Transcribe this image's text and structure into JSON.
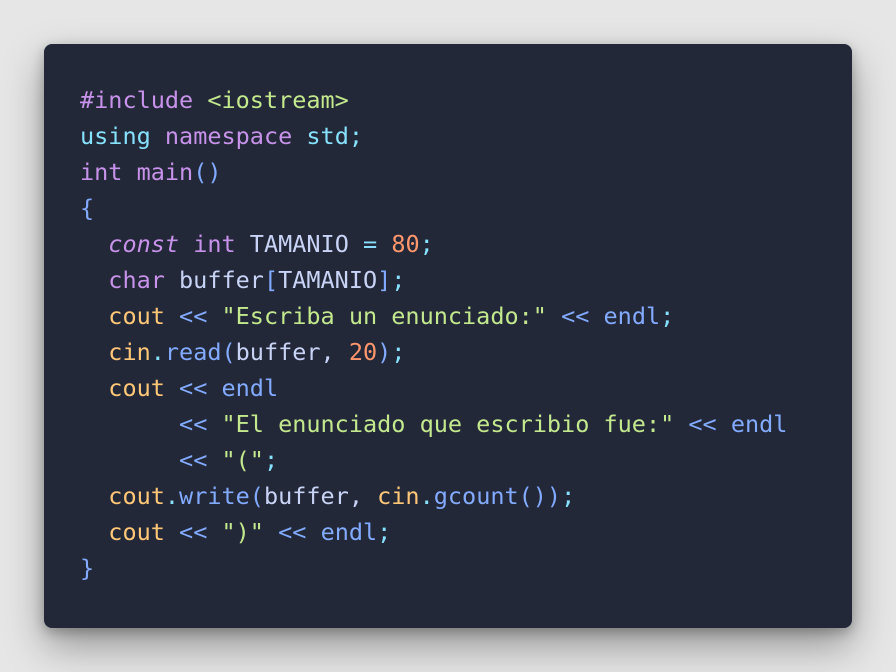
{
  "colors": {
    "background": "#e6e6e6",
    "editor_bg": "#232838",
    "keyword": "#c792ea",
    "type": "#ab8ff0",
    "identifier": "#c8d3f5",
    "function": "#82aaff",
    "operator": "#89ddff",
    "string": "#c3e88d",
    "number": "#ff966c",
    "stream": "#ffc777",
    "namespace_std": "#86e1fc",
    "punct": "#c8d3f5"
  },
  "code": {
    "language": "cpp",
    "lines": [
      {
        "tokens": [
          {
            "text": "#include",
            "color": "#c792ea"
          },
          {
            "text": " ",
            "color": "#c8d3f5"
          },
          {
            "text": "<iostream>",
            "color": "#c3e88d"
          }
        ]
      },
      {
        "tokens": [
          {
            "text": "using",
            "color": "#86e1fc"
          },
          {
            "text": " ",
            "color": "#c8d3f5"
          },
          {
            "text": "namespace",
            "color": "#c792ea"
          },
          {
            "text": " ",
            "color": "#c8d3f5"
          },
          {
            "text": "std",
            "color": "#86e1fc"
          },
          {
            "text": ";",
            "color": "#86e1fc"
          }
        ]
      },
      {
        "tokens": [
          {
            "text": "int",
            "color": "#c792ea"
          },
          {
            "text": " ",
            "color": "#c8d3f5"
          },
          {
            "text": "main",
            "color": "#c792ea"
          },
          {
            "text": "()",
            "color": "#82aaff"
          }
        ]
      },
      {
        "tokens": [
          {
            "text": "{",
            "color": "#82aaff"
          }
        ]
      },
      {
        "tokens": [
          {
            "text": "  ",
            "color": "#c8d3f5"
          },
          {
            "text": "const",
            "color": "#c792ea",
            "italic": true
          },
          {
            "text": " ",
            "color": "#c8d3f5"
          },
          {
            "text": "int",
            "color": "#c792ea"
          },
          {
            "text": " TAMANIO ",
            "color": "#c8d3f5"
          },
          {
            "text": "=",
            "color": "#89ddff"
          },
          {
            "text": " ",
            "color": "#c8d3f5"
          },
          {
            "text": "80",
            "color": "#ff966c"
          },
          {
            "text": ";",
            "color": "#86e1fc"
          }
        ]
      },
      {
        "tokens": [
          {
            "text": "  ",
            "color": "#c8d3f5"
          },
          {
            "text": "char",
            "color": "#c792ea"
          },
          {
            "text": " buffer",
            "color": "#c8d3f5"
          },
          {
            "text": "[",
            "color": "#82aaff"
          },
          {
            "text": "TAMANIO",
            "color": "#c8d3f5"
          },
          {
            "text": "]",
            "color": "#82aaff"
          },
          {
            "text": ";",
            "color": "#86e1fc"
          }
        ]
      },
      {
        "tokens": [
          {
            "text": "  ",
            "color": "#c8d3f5"
          },
          {
            "text": "cout",
            "color": "#ffc777"
          },
          {
            "text": " ",
            "color": "#c8d3f5"
          },
          {
            "text": "<<",
            "color": "#82aaff"
          },
          {
            "text": " ",
            "color": "#c8d3f5"
          },
          {
            "text": "\"Escriba un enunciado:\"",
            "color": "#c3e88d"
          },
          {
            "text": " ",
            "color": "#c8d3f5"
          },
          {
            "text": "<<",
            "color": "#82aaff"
          },
          {
            "text": " ",
            "color": "#c8d3f5"
          },
          {
            "text": "endl",
            "color": "#82aaff"
          },
          {
            "text": ";",
            "color": "#86e1fc"
          }
        ]
      },
      {
        "tokens": [
          {
            "text": "  ",
            "color": "#c8d3f5"
          },
          {
            "text": "cin",
            "color": "#ffc777"
          },
          {
            "text": ".",
            "color": "#86e1fc"
          },
          {
            "text": "read",
            "color": "#82aaff"
          },
          {
            "text": "(",
            "color": "#82aaff"
          },
          {
            "text": "buffer",
            "color": "#c8d3f5"
          },
          {
            "text": ", ",
            "color": "#c8d3f5"
          },
          {
            "text": "20",
            "color": "#ff966c"
          },
          {
            "text": ")",
            "color": "#82aaff"
          },
          {
            "text": ";",
            "color": "#86e1fc"
          }
        ]
      },
      {
        "tokens": [
          {
            "text": "  ",
            "color": "#c8d3f5"
          },
          {
            "text": "cout",
            "color": "#ffc777"
          },
          {
            "text": " ",
            "color": "#c8d3f5"
          },
          {
            "text": "<<",
            "color": "#82aaff"
          },
          {
            "text": " ",
            "color": "#c8d3f5"
          },
          {
            "text": "endl",
            "color": "#82aaff"
          }
        ]
      },
      {
        "tokens": [
          {
            "text": "       ",
            "color": "#c8d3f5"
          },
          {
            "text": "<<",
            "color": "#82aaff"
          },
          {
            "text": " ",
            "color": "#c8d3f5"
          },
          {
            "text": "\"El enunciado que escribio fue:\"",
            "color": "#c3e88d"
          },
          {
            "text": " ",
            "color": "#c8d3f5"
          },
          {
            "text": "<<",
            "color": "#82aaff"
          },
          {
            "text": " ",
            "color": "#c8d3f5"
          },
          {
            "text": "endl",
            "color": "#82aaff"
          }
        ]
      },
      {
        "tokens": [
          {
            "text": "       ",
            "color": "#c8d3f5"
          },
          {
            "text": "<<",
            "color": "#82aaff"
          },
          {
            "text": " ",
            "color": "#c8d3f5"
          },
          {
            "text": "\"(\"",
            "color": "#c3e88d"
          },
          {
            "text": ";",
            "color": "#86e1fc"
          }
        ]
      },
      {
        "tokens": [
          {
            "text": "  ",
            "color": "#c8d3f5"
          },
          {
            "text": "cout",
            "color": "#ffc777"
          },
          {
            "text": ".",
            "color": "#86e1fc"
          },
          {
            "text": "write",
            "color": "#82aaff"
          },
          {
            "text": "(",
            "color": "#82aaff"
          },
          {
            "text": "buffer",
            "color": "#c8d3f5"
          },
          {
            "text": ", ",
            "color": "#c8d3f5"
          },
          {
            "text": "cin",
            "color": "#ffc777"
          },
          {
            "text": ".",
            "color": "#86e1fc"
          },
          {
            "text": "gcount",
            "color": "#82aaff"
          },
          {
            "text": "())",
            "color": "#82aaff"
          },
          {
            "text": ";",
            "color": "#86e1fc"
          }
        ]
      },
      {
        "tokens": [
          {
            "text": "  ",
            "color": "#c8d3f5"
          },
          {
            "text": "cout",
            "color": "#ffc777"
          },
          {
            "text": " ",
            "color": "#c8d3f5"
          },
          {
            "text": "<<",
            "color": "#82aaff"
          },
          {
            "text": " ",
            "color": "#c8d3f5"
          },
          {
            "text": "\")\"",
            "color": "#c3e88d"
          },
          {
            "text": " ",
            "color": "#c8d3f5"
          },
          {
            "text": "<<",
            "color": "#82aaff"
          },
          {
            "text": " ",
            "color": "#c8d3f5"
          },
          {
            "text": "endl",
            "color": "#82aaff"
          },
          {
            "text": ";",
            "color": "#86e1fc"
          }
        ]
      },
      {
        "tokens": [
          {
            "text": "}",
            "color": "#82aaff"
          }
        ]
      }
    ]
  }
}
